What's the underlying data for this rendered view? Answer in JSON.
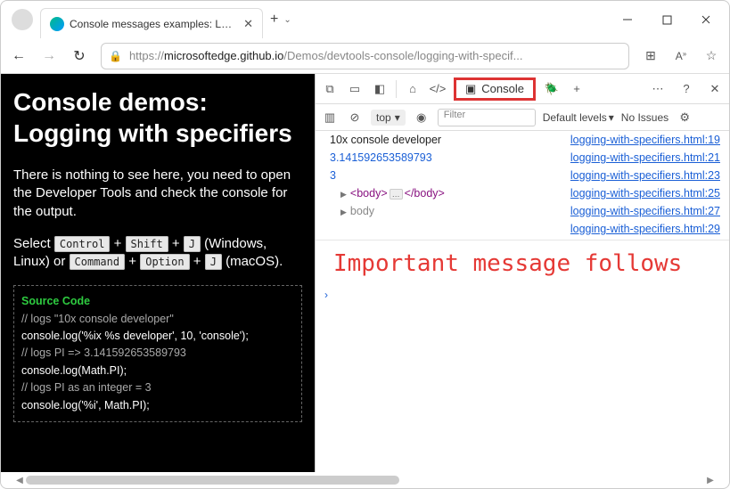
{
  "window": {
    "tab_title": "Console messages examples: Log...",
    "url_light_prefix": "https://",
    "url_dark_host": "microsoftedge.github.io",
    "url_light_path": "/Demos/devtools-console/logging-with-specif..."
  },
  "page": {
    "heading": "Console demos: Logging with specifiers",
    "p1": "There is nothing to see here, you need to open the Developer Tools and check the console for the output.",
    "p2a": "Select ",
    "p2b": " + ",
    "p2c": " (Windows, Linux) or ",
    "p2d": " (macOS).",
    "kbd_control": "Control",
    "kbd_shift": "Shift",
    "kbd_j": "J",
    "kbd_command": "Command",
    "kbd_option": "Option",
    "code": {
      "header": "Source Code",
      "l1": "// logs \"10x console developer\"",
      "l2": "console.log('%ix %s developer', 10, 'console');",
      "l3": "// logs PI => 3.141592653589793",
      "l4": "console.log(Math.PI);",
      "l5": "// logs PI as an integer = 3",
      "l6": "console.log('%i', Math.PI);"
    }
  },
  "devtools": {
    "tabs": {
      "console": "Console"
    },
    "toolbar": {
      "context": "top",
      "filter_placeholder": "Filter",
      "levels": "Default levels",
      "issues": "No Issues"
    },
    "logs": [
      {
        "msg": "10x console developer",
        "link": "logging-with-specifiers.html:19"
      },
      {
        "msg": "3.141592653589793",
        "link": "logging-with-specifiers.html:21",
        "blue": true
      },
      {
        "msg": "3",
        "link": "logging-with-specifiers.html:23",
        "blue": true
      },
      {
        "body_html": true,
        "link": "logging-with-specifiers.html:25"
      },
      {
        "body_gray": true,
        "link": "logging-with-specifiers.html:27"
      },
      {
        "msg": "",
        "link": "logging-with-specifiers.html:29"
      }
    ],
    "body_label": "body",
    "big_message": "Important message follows"
  }
}
